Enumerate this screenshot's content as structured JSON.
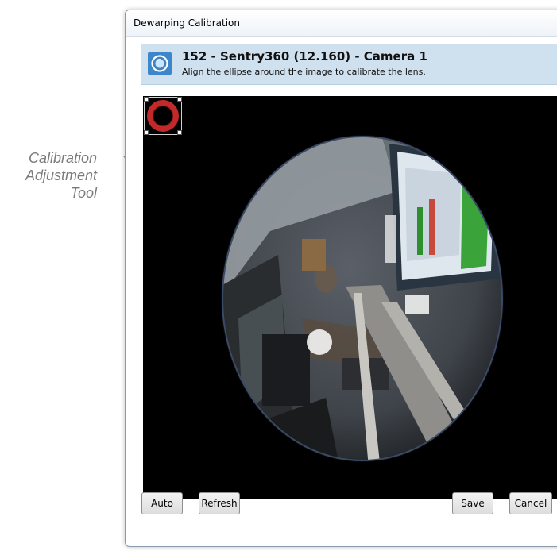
{
  "callout": {
    "line1": "Calibration",
    "line2": "Adjustment",
    "line3": "Tool"
  },
  "window": {
    "title": "Dewarping Calibration"
  },
  "banner": {
    "heading": "152 - Sentry360 (12.160) - Camera 1",
    "subtitle": "Align the ellipse around the image to calibrate the lens.",
    "icon": "camera-lens-icon"
  },
  "viewer": {
    "tool_icon": "calibration-ellipse-icon",
    "ring_color": "#c02a2a"
  },
  "buttons": {
    "auto": "Auto",
    "refresh": "Refresh",
    "save": "Save",
    "cancel": "Cancel"
  },
  "colors": {
    "banner_bg": "#cfe0ee",
    "accent": "#3d86c9",
    "viewer_bg": "#000000"
  }
}
